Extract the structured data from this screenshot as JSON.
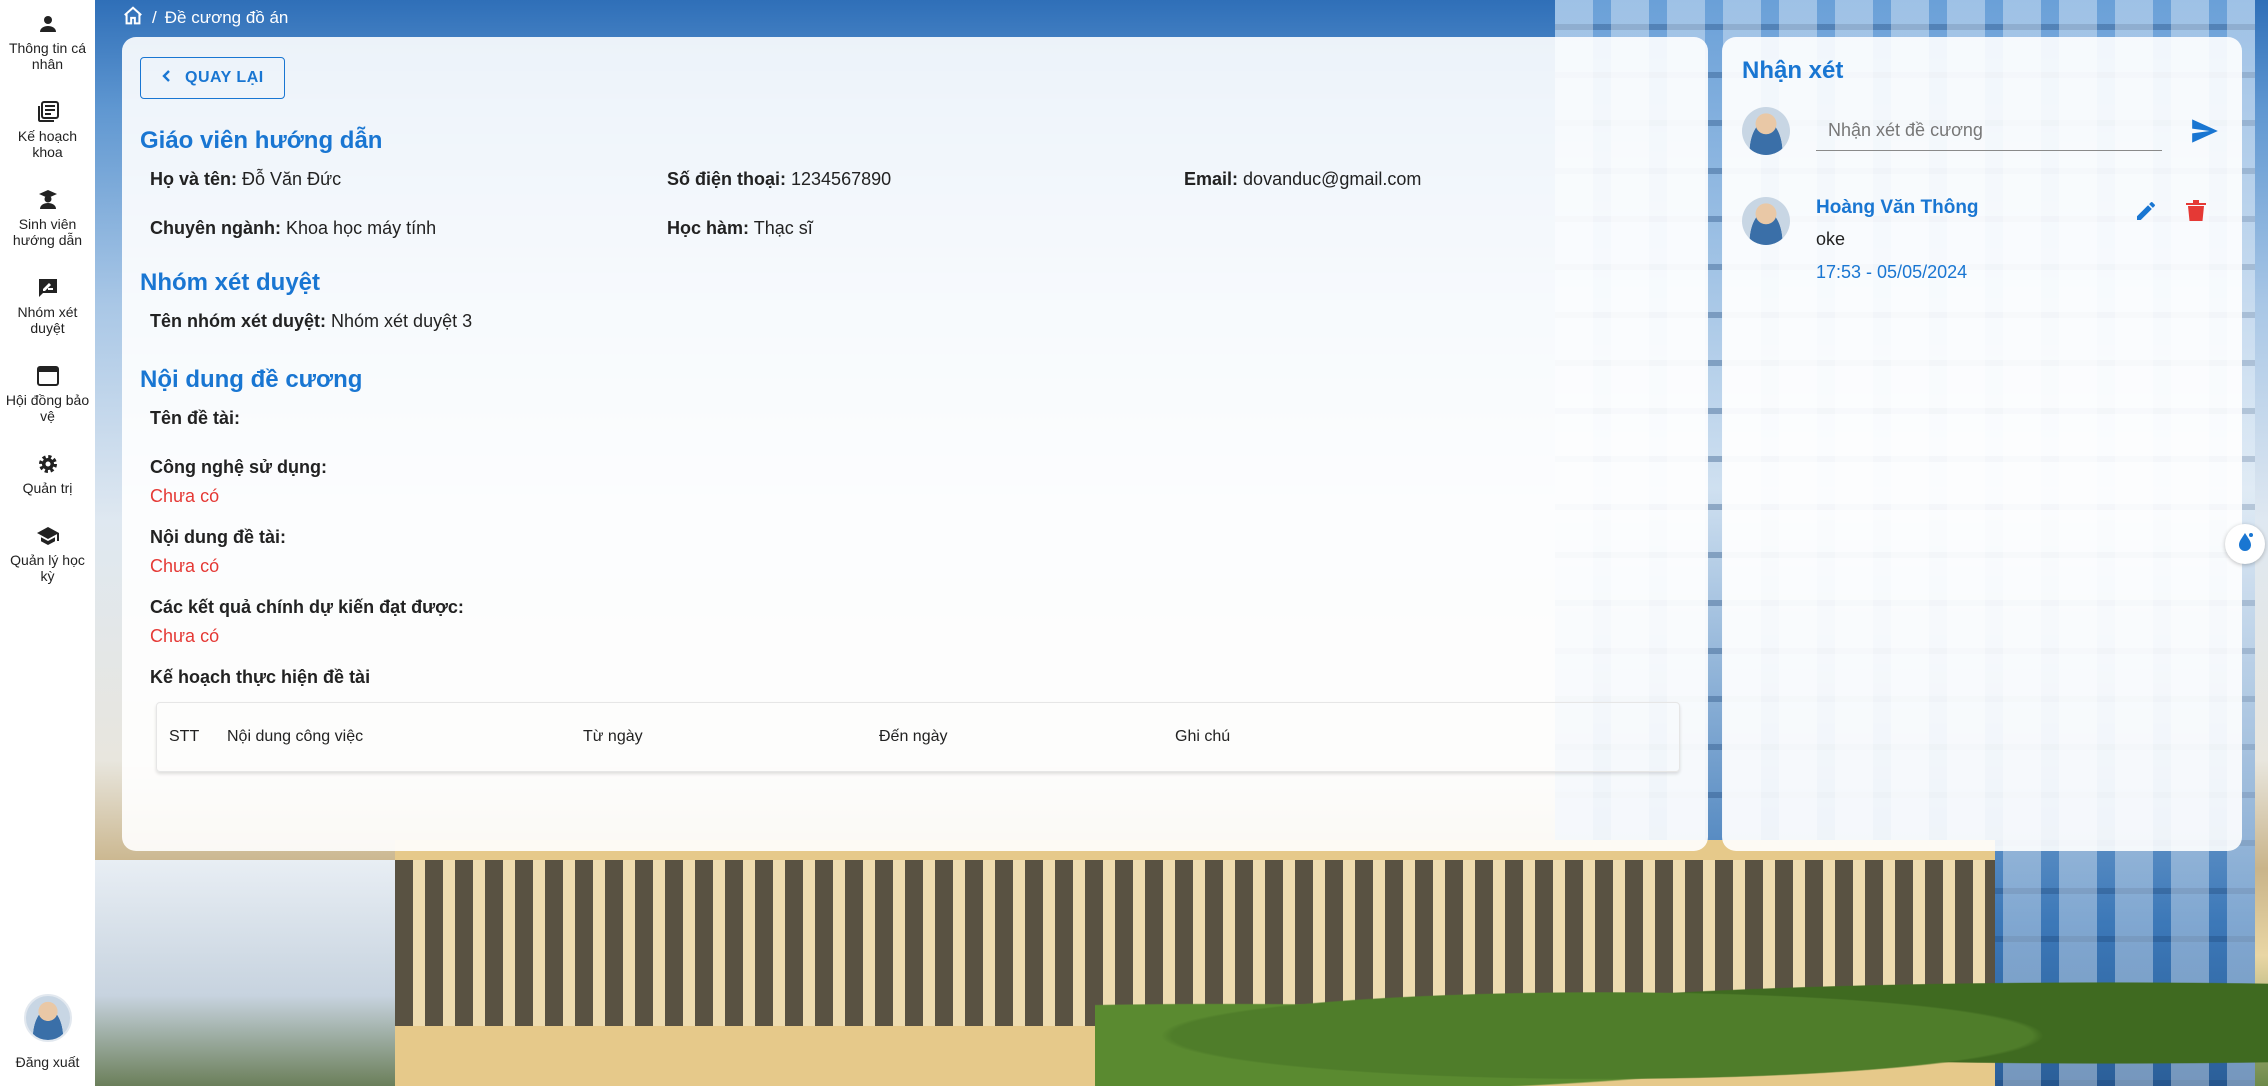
{
  "sidebar": {
    "items": [
      {
        "label": "Thông tin cá nhân",
        "icon": "person-icon"
      },
      {
        "label": "Kế hoạch khoa",
        "icon": "library-books-icon"
      },
      {
        "label": "Sinh viên hướng dẫn",
        "icon": "student-icon"
      },
      {
        "label": "Nhóm xét duyệt",
        "icon": "rate-review-icon"
      },
      {
        "label": "Hội đồng bảo vệ",
        "icon": "web-asset-icon"
      },
      {
        "label": "Quản trị",
        "icon": "gear-icon"
      },
      {
        "label": "Quản lý học kỳ",
        "icon": "school-icon"
      }
    ],
    "logout_label": "Đăng xuất"
  },
  "breadcrumb": {
    "separator": "/",
    "current": "Đề cương đồ án"
  },
  "main": {
    "back_label": "QUAY LẠI",
    "advisor": {
      "title": "Giáo viên hướng dẫn",
      "name_label": "Họ và tên:",
      "name": "Đỗ Văn Đức",
      "phone_label": "Số điện thoại:",
      "phone": "1234567890",
      "email_label": "Email:",
      "email": "dovanduc@gmail.com",
      "major_label": "Chuyên ngành:",
      "major": "Khoa học máy tính",
      "degree_label": "Học hàm:",
      "degree": "Thạc sĩ"
    },
    "review_group": {
      "title": "Nhóm xét duyệt",
      "name_label": "Tên nhóm xét duyệt:",
      "name": "Nhóm xét duyệt 3"
    },
    "outline": {
      "title": "Nội dung đề cương",
      "topic_label": "Tên đề tài:",
      "tech_label": "Công nghệ sử dụng:",
      "tech_value": "Chưa có",
      "content_label": "Nội dung đề tài:",
      "content_value": "Chưa có",
      "results_label": "Các kết quả chính dự kiến đạt được:",
      "results_value": "Chưa có",
      "plan_label": "Kế hoạch thực hiện đề tài",
      "plan_columns": [
        "STT",
        "Nội dung công việc",
        "Từ ngày",
        "Đến ngày",
        "Ghi chú"
      ]
    }
  },
  "comments": {
    "title": "Nhận xét",
    "input_placeholder": "Nhận xét đề cương",
    "items": [
      {
        "author": "Hoàng Văn Thông",
        "text": "oke",
        "time": "17:53 - 05/05/2024"
      }
    ]
  },
  "colors": {
    "accent": "#1976d2",
    "empty_value": "#e53935",
    "delete": "#e53935"
  }
}
